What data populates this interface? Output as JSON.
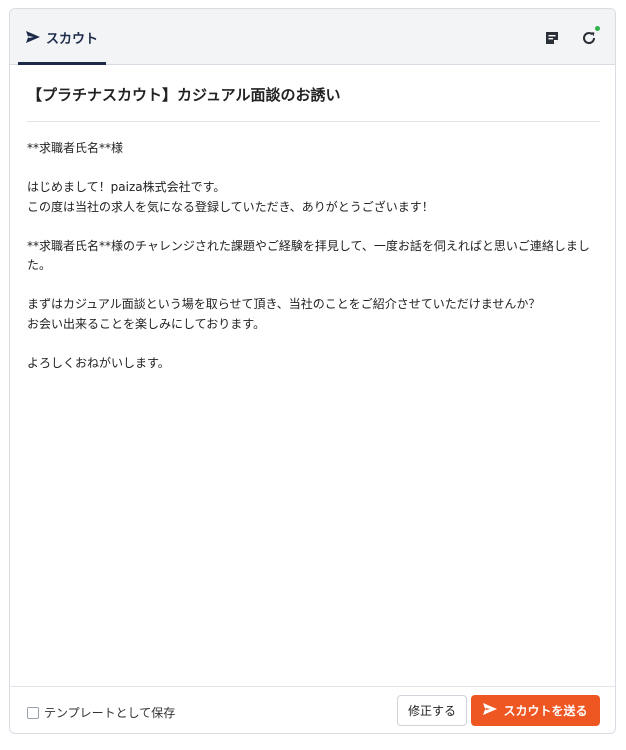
{
  "header": {
    "tab_label": "スカウト",
    "tab_icon": "send-icon",
    "memo_icon": "memo-icon",
    "refresh_icon": "refresh-icon",
    "status_dot_color": "#2db34a"
  },
  "message": {
    "subject": "【プラチナスカウト】カジュアル面談のお誘い",
    "paragraphs": [
      [
        "**求職者氏名**様"
      ],
      [
        "はじめまして！paiza株式会社です。",
        "この度は当社の求人を気になる登録していただき、ありがとうございます！"
      ],
      [
        "**求職者氏名**様のチャレンジされた課題やご経験を拝見して、一度お話を伺えればと思いご連絡しました。"
      ],
      [
        "まずはカジュアル面談という場を取らせて頂き、当社のことをご紹介させていただけませんか？",
        "お会い出来ることを楽しみにしております。"
      ],
      [
        "よろしくおねがいします。"
      ]
    ]
  },
  "footer": {
    "template_checkbox_label": "テンプレートとして保存",
    "template_checked": false,
    "edit_label": "修正する",
    "send_label": "スカウトを送る",
    "send_color": "#ee5622"
  },
  "colors": {
    "accent_navy": "#1c2b4a",
    "header_bg": "#f3f4f6",
    "border": "#d9dde3"
  }
}
